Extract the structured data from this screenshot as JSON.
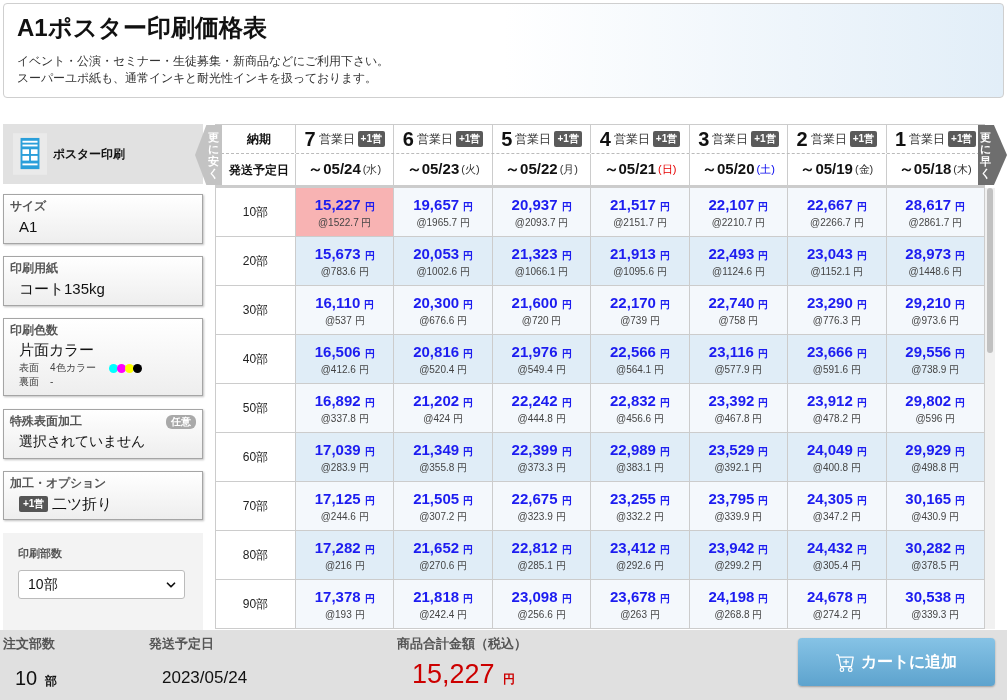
{
  "header": {
    "title": "A1ポスター印刷価格表",
    "description": [
      "イベント・公演・セミナー・生徒募集・新商品などにご利用下さい。",
      "スーパーユポ紙も、通常インキと耐光性インキを扱っております。"
    ]
  },
  "sidebar": {
    "product": "ポスター印刷",
    "options": [
      {
        "kind": "plain",
        "label": "サイズ",
        "value": "A1"
      },
      {
        "kind": "plain",
        "label": "印刷用紙",
        "value": "コート135kg"
      },
      {
        "kind": "colors",
        "label": "印刷色数",
        "value": "片面カラー",
        "sides": [
          {
            "name": "表面",
            "value": "4色カラー",
            "inks": [
              {
                "color": "#00ffff"
              },
              {
                "color": "#ff00ff"
              },
              {
                "color": "#ffff00"
              },
              {
                "color": "#000000"
              }
            ]
          },
          {
            "name": "裏面",
            "value": "-"
          }
        ]
      },
      {
        "kind": "optional",
        "label": "特殊表面加工",
        "badge": "任意",
        "value": "選択されていません"
      },
      {
        "kind": "option",
        "label": "加工・オプション",
        "badge": "+1営",
        "value": "二ツ折り"
      }
    ],
    "quantity": {
      "label": "印刷部数",
      "value": "10部"
    }
  },
  "table": {
    "nav_left": "更に安く",
    "nav_right": "更に早く",
    "header_labels": [
      "納期",
      "発送予定日"
    ],
    "columns": [
      {
        "days": "7",
        "unit": "営業日",
        "badge": "+1営",
        "date": "～05/24",
        "weekday": "(水)",
        "kind": "weekday"
      },
      {
        "days": "6",
        "unit": "営業日",
        "badge": "+1営",
        "date": "～05/23",
        "weekday": "(火)",
        "kind": "weekday"
      },
      {
        "days": "5",
        "unit": "営業日",
        "badge": "+1営",
        "date": "～05/22",
        "weekday": "(月)",
        "kind": "weekday"
      },
      {
        "days": "4",
        "unit": "営業日",
        "badge": "+1営",
        "date": "～05/21",
        "weekday": "(日)",
        "kind": "sunday"
      },
      {
        "days": "3",
        "unit": "営業日",
        "badge": "+1営",
        "date": "～05/20",
        "weekday": "(土)",
        "kind": "saturday"
      },
      {
        "days": "2",
        "unit": "営業日",
        "badge": "+1営",
        "date": "～05/19",
        "weekday": "(金)",
        "kind": "weekday"
      },
      {
        "days": "1",
        "unit": "営業日",
        "badge": "+1営",
        "date": "～05/18",
        "weekday": "(木)",
        "kind": "weekday"
      }
    ],
    "rows": [
      {
        "label": "10部",
        "cells": [
          {
            "price": "15,227",
            "unit": "円",
            "each": "@1522.7 円",
            "selected": true
          },
          {
            "price": "19,657",
            "unit": "円",
            "each": "@1965.7 円",
            "selected": false
          },
          {
            "price": "20,937",
            "unit": "円",
            "each": "@2093.7 円",
            "selected": false
          },
          {
            "price": "21,517",
            "unit": "円",
            "each": "@2151.7 円",
            "selected": false
          },
          {
            "price": "22,107",
            "unit": "円",
            "each": "@2210.7 円",
            "selected": false
          },
          {
            "price": "22,667",
            "unit": "円",
            "each": "@2266.7 円",
            "selected": false
          },
          {
            "price": "28,617",
            "unit": "円",
            "each": "@2861.7 円",
            "selected": false
          }
        ]
      },
      {
        "label": "20部",
        "cells": [
          {
            "price": "15,673",
            "unit": "円",
            "each": "@783.6 円",
            "selected": false
          },
          {
            "price": "20,053",
            "unit": "円",
            "each": "@1002.6 円",
            "selected": false
          },
          {
            "price": "21,323",
            "unit": "円",
            "each": "@1066.1 円",
            "selected": false
          },
          {
            "price": "21,913",
            "unit": "円",
            "each": "@1095.6 円",
            "selected": false
          },
          {
            "price": "22,493",
            "unit": "円",
            "each": "@1124.6 円",
            "selected": false
          },
          {
            "price": "23,043",
            "unit": "円",
            "each": "@1152.1 円",
            "selected": false
          },
          {
            "price": "28,973",
            "unit": "円",
            "each": "@1448.6 円",
            "selected": false
          }
        ]
      },
      {
        "label": "30部",
        "cells": [
          {
            "price": "16,110",
            "unit": "円",
            "each": "@537 円",
            "selected": false
          },
          {
            "price": "20,300",
            "unit": "円",
            "each": "@676.6 円",
            "selected": false
          },
          {
            "price": "21,600",
            "unit": "円",
            "each": "@720 円",
            "selected": false
          },
          {
            "price": "22,170",
            "unit": "円",
            "each": "@739 円",
            "selected": false
          },
          {
            "price": "22,740",
            "unit": "円",
            "each": "@758 円",
            "selected": false
          },
          {
            "price": "23,290",
            "unit": "円",
            "each": "@776.3 円",
            "selected": false
          },
          {
            "price": "29,210",
            "unit": "円",
            "each": "@973.6 円",
            "selected": false
          }
        ]
      },
      {
        "label": "40部",
        "cells": [
          {
            "price": "16,506",
            "unit": "円",
            "each": "@412.6 円",
            "selected": false
          },
          {
            "price": "20,816",
            "unit": "円",
            "each": "@520.4 円",
            "selected": false
          },
          {
            "price": "21,976",
            "unit": "円",
            "each": "@549.4 円",
            "selected": false
          },
          {
            "price": "22,566",
            "unit": "円",
            "each": "@564.1 円",
            "selected": false
          },
          {
            "price": "23,116",
            "unit": "円",
            "each": "@577.9 円",
            "selected": false
          },
          {
            "price": "23,666",
            "unit": "円",
            "each": "@591.6 円",
            "selected": false
          },
          {
            "price": "29,556",
            "unit": "円",
            "each": "@738.9 円",
            "selected": false
          }
        ]
      },
      {
        "label": "50部",
        "cells": [
          {
            "price": "16,892",
            "unit": "円",
            "each": "@337.8 円",
            "selected": false
          },
          {
            "price": "21,202",
            "unit": "円",
            "each": "@424 円",
            "selected": false
          },
          {
            "price": "22,242",
            "unit": "円",
            "each": "@444.8 円",
            "selected": false
          },
          {
            "price": "22,832",
            "unit": "円",
            "each": "@456.6 円",
            "selected": false
          },
          {
            "price": "23,392",
            "unit": "円",
            "each": "@467.8 円",
            "selected": false
          },
          {
            "price": "23,912",
            "unit": "円",
            "each": "@478.2 円",
            "selected": false
          },
          {
            "price": "29,802",
            "unit": "円",
            "each": "@596 円",
            "selected": false
          }
        ]
      },
      {
        "label": "60部",
        "cells": [
          {
            "price": "17,039",
            "unit": "円",
            "each": "@283.9 円",
            "selected": false
          },
          {
            "price": "21,349",
            "unit": "円",
            "each": "@355.8 円",
            "selected": false
          },
          {
            "price": "22,399",
            "unit": "円",
            "each": "@373.3 円",
            "selected": false
          },
          {
            "price": "22,989",
            "unit": "円",
            "each": "@383.1 円",
            "selected": false
          },
          {
            "price": "23,529",
            "unit": "円",
            "each": "@392.1 円",
            "selected": false
          },
          {
            "price": "24,049",
            "unit": "円",
            "each": "@400.8 円",
            "selected": false
          },
          {
            "price": "29,929",
            "unit": "円",
            "each": "@498.8 円",
            "selected": false
          }
        ]
      },
      {
        "label": "70部",
        "cells": [
          {
            "price": "17,125",
            "unit": "円",
            "each": "@244.6 円",
            "selected": false
          },
          {
            "price": "21,505",
            "unit": "円",
            "each": "@307.2 円",
            "selected": false
          },
          {
            "price": "22,675",
            "unit": "円",
            "each": "@323.9 円",
            "selected": false
          },
          {
            "price": "23,255",
            "unit": "円",
            "each": "@332.2 円",
            "selected": false
          },
          {
            "price": "23,795",
            "unit": "円",
            "each": "@339.9 円",
            "selected": false
          },
          {
            "price": "24,305",
            "unit": "円",
            "each": "@347.2 円",
            "selected": false
          },
          {
            "price": "30,165",
            "unit": "円",
            "each": "@430.9 円",
            "selected": false
          }
        ]
      },
      {
        "label": "80部",
        "cells": [
          {
            "price": "17,282",
            "unit": "円",
            "each": "@216 円",
            "selected": false
          },
          {
            "price": "21,652",
            "unit": "円",
            "each": "@270.6 円",
            "selected": false
          },
          {
            "price": "22,812",
            "unit": "円",
            "each": "@285.1 円",
            "selected": false
          },
          {
            "price": "23,412",
            "unit": "円",
            "each": "@292.6 円",
            "selected": false
          },
          {
            "price": "23,942",
            "unit": "円",
            "each": "@299.2 円",
            "selected": false
          },
          {
            "price": "24,432",
            "unit": "円",
            "each": "@305.4 円",
            "selected": false
          },
          {
            "price": "30,282",
            "unit": "円",
            "each": "@378.5 円",
            "selected": false
          }
        ]
      },
      {
        "label": "90部",
        "cells": [
          {
            "price": "17,378",
            "unit": "円",
            "each": "@193 円",
            "selected": false
          },
          {
            "price": "21,818",
            "unit": "円",
            "each": "@242.4 円",
            "selected": false
          },
          {
            "price": "23,098",
            "unit": "円",
            "each": "@256.6 円",
            "selected": false
          },
          {
            "price": "23,678",
            "unit": "円",
            "each": "@263 円",
            "selected": false
          },
          {
            "price": "24,198",
            "unit": "円",
            "each": "@268.8 円",
            "selected": false
          },
          {
            "price": "24,678",
            "unit": "円",
            "each": "@274.2 円",
            "selected": false
          },
          {
            "price": "30,538",
            "unit": "円",
            "each": "@339.3 円",
            "selected": false
          }
        ]
      }
    ]
  },
  "footer": {
    "order_quantity": {
      "label": "注文部数",
      "value": "10",
      "unit": "部"
    },
    "ship_date": {
      "label": "発送予定日",
      "value": "2023/05/24"
    },
    "total": {
      "label": "商品合計金額（税込）",
      "value": "15,227",
      "unit": "円"
    },
    "cart_button": "カートに追加"
  }
}
